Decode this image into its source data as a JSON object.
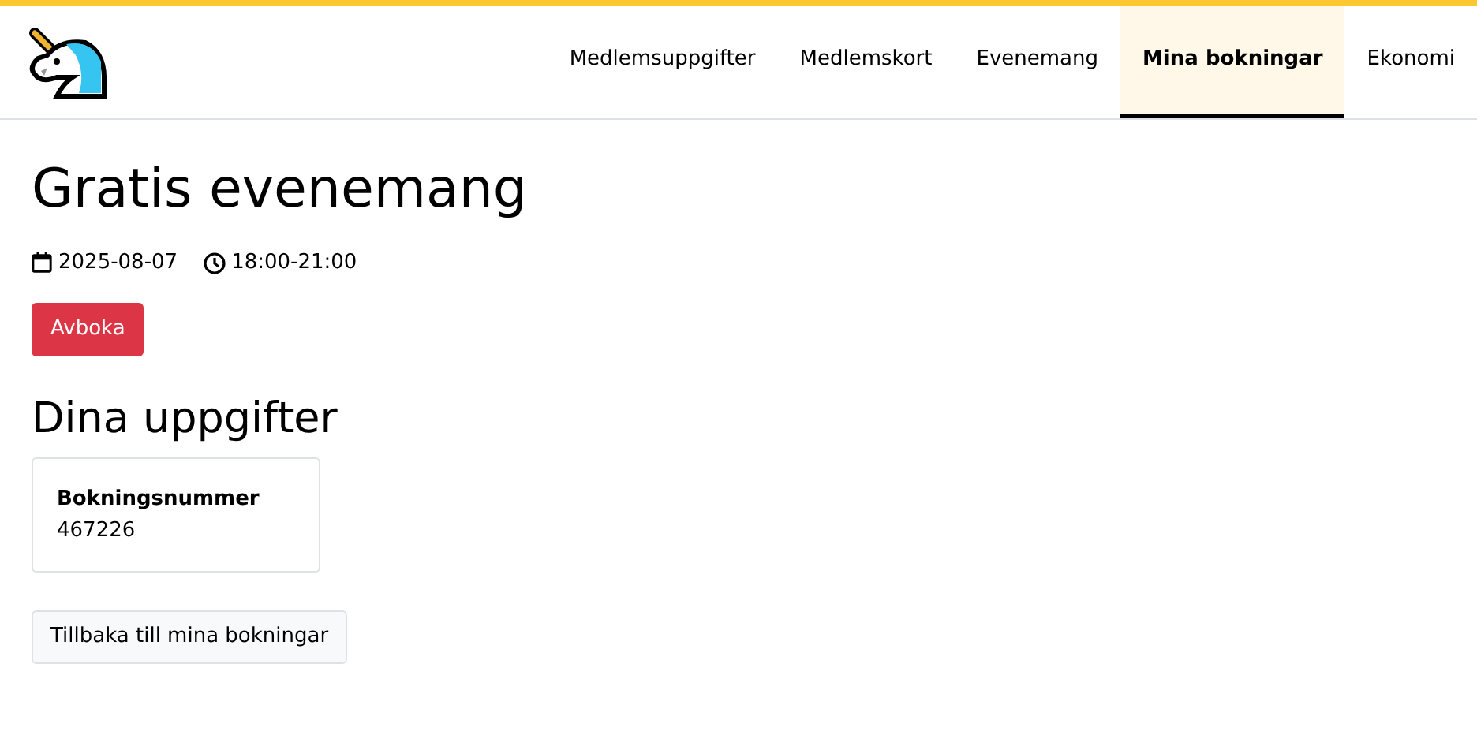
{
  "nav": [
    {
      "label": "Medlemsuppgifter",
      "selected": false
    },
    {
      "label": "Medlemskort",
      "selected": false
    },
    {
      "label": "Evenemang",
      "selected": false
    },
    {
      "label": "Mina bokningar",
      "selected": true
    },
    {
      "label": "Ekonomi",
      "selected": false
    }
  ],
  "title": "Gratis evenemang",
  "date": "2025-08-07",
  "time": "18:00-21:00",
  "cancel_button": "Avboka",
  "section_title": "Dina uppgifter",
  "details": [
    {
      "label": "Bokningsnummer",
      "value": "467226"
    }
  ],
  "back_button": "Tillbaka till mina bokningar"
}
